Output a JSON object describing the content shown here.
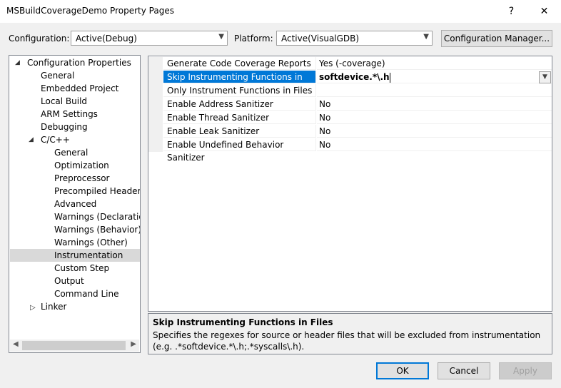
{
  "window": {
    "title": "MSBuildCoverageDemo Property Pages",
    "help": "?",
    "close": "✕"
  },
  "configuration": {
    "label": "Configuration:",
    "value": "Active(Debug)"
  },
  "platform": {
    "label": "Platform:",
    "value": "Active(VisualGDB)"
  },
  "config_manager_label": "Configuration Manager...",
  "tree": [
    {
      "label": "Configuration Properties"
    },
    {
      "label": "General"
    },
    {
      "label": "Embedded Project"
    },
    {
      "label": "Local Build"
    },
    {
      "label": "ARM Settings"
    },
    {
      "label": "Debugging"
    },
    {
      "label": "C/C++"
    },
    {
      "label": "General"
    },
    {
      "label": "Optimization"
    },
    {
      "label": "Preprocessor"
    },
    {
      "label": "Precompiled Headers"
    },
    {
      "label": "Advanced"
    },
    {
      "label": "Warnings (Declarations)"
    },
    {
      "label": "Warnings (Behavior)"
    },
    {
      "label": "Warnings (Other)"
    },
    {
      "label": "Instrumentation"
    },
    {
      "label": "Custom Step"
    },
    {
      "label": "Output"
    },
    {
      "label": "Command Line"
    },
    {
      "label": "Linker"
    }
  ],
  "properties": [
    {
      "name": "Generate Code Coverage Reports",
      "value": "Yes (-coverage)"
    },
    {
      "name": "Skip Instrumenting Functions in Files",
      "value": "softdevice.*\\.h"
    },
    {
      "name": "Only Instrument Functions in Files",
      "value": ""
    },
    {
      "name": "Enable Address Sanitizer",
      "value": "No"
    },
    {
      "name": "Enable Thread Sanitizer",
      "value": "No"
    },
    {
      "name": "Enable Leak Sanitizer",
      "value": "No"
    },
    {
      "name": "Enable Undefined Behavior Sanitizer",
      "value": "No"
    }
  ],
  "description": {
    "title": "Skip Instrumenting Functions in Files",
    "text": "Specifies the regexes for source or header files that will be excluded from instrumentation (e.g. .*softdevice.*\\.h;.*syscalls\\.h)."
  },
  "buttons": {
    "ok": "OK",
    "cancel": "Cancel",
    "apply": "Apply"
  },
  "colors": {
    "selection": "#0078d7",
    "tree_selection": "#d9d9d9"
  }
}
